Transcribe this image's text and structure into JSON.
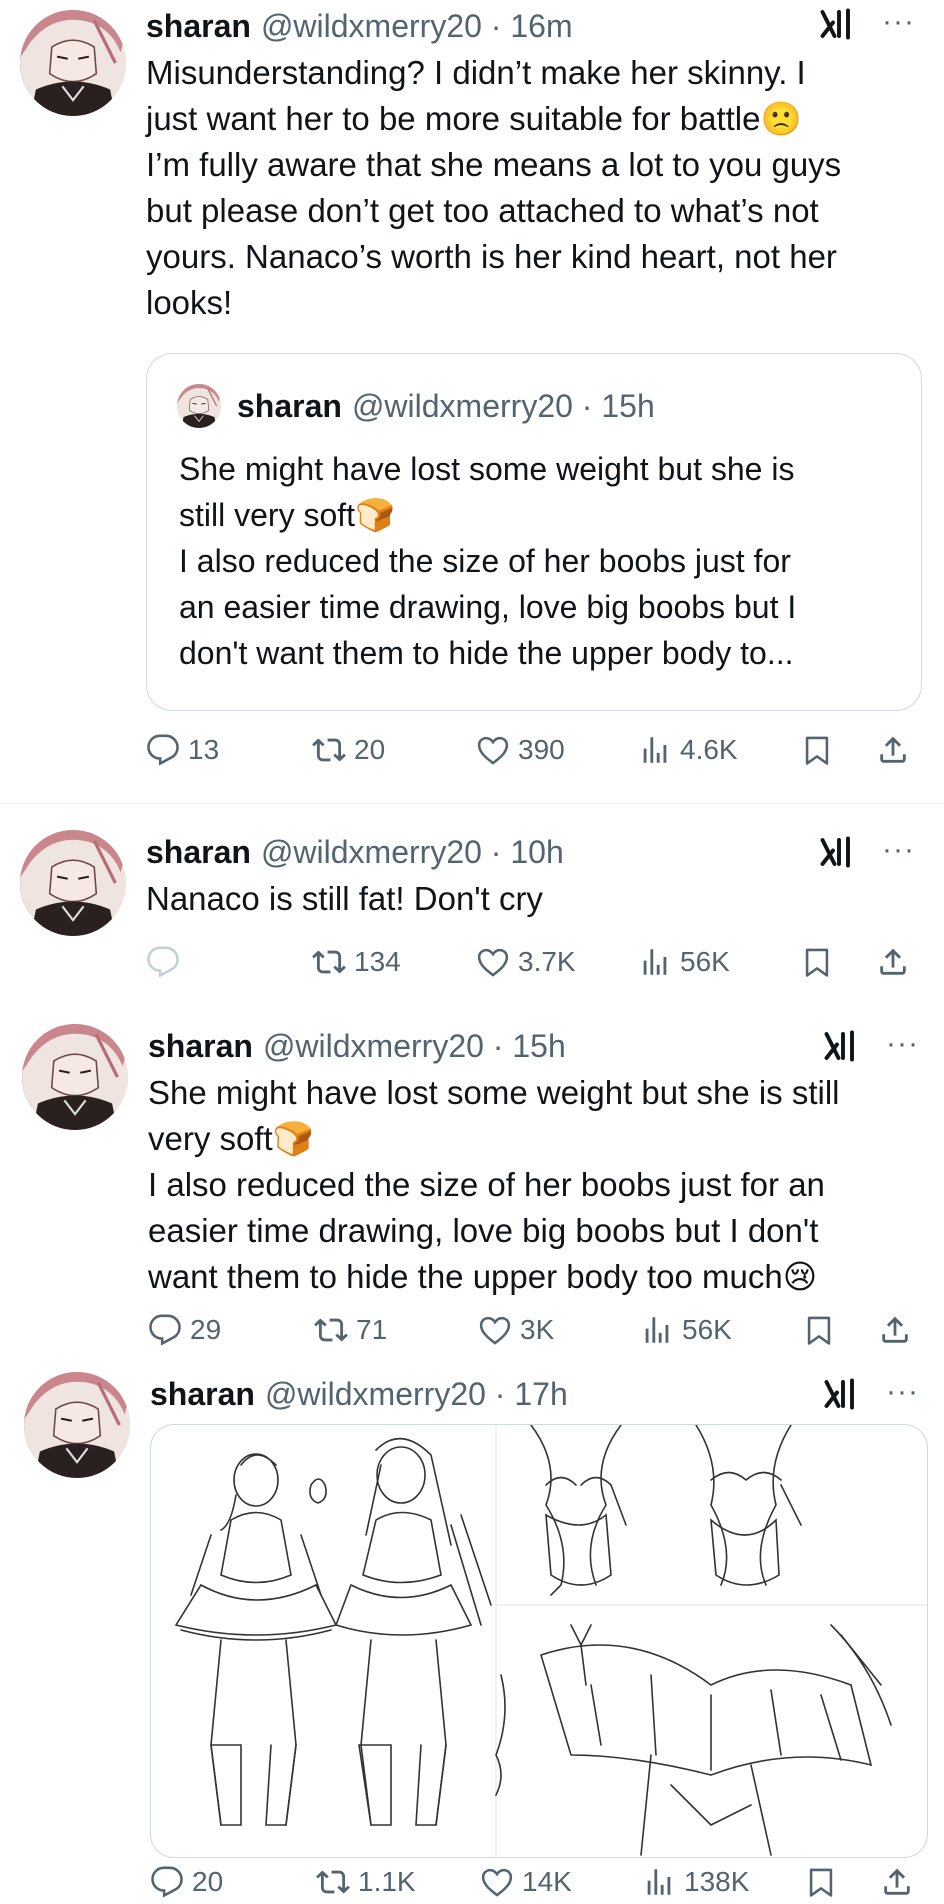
{
  "tweets": [
    {
      "name": "sharan",
      "handle": "@wildxmerry20 · 16m",
      "text": "Misunderstanding? I didn’t make her skinny. I\njust want her to be more suitable for battle🙁\nI’m fully aware that she means a lot to you guys\nbut please don’t get too attached to what’s not\nyours. Nanaco’s worth is her kind heart, not her\nlooks!",
      "quote": {
        "name": "sharan",
        "handle": "@wildxmerry20 · 15h",
        "text": "She might have lost some weight but she is\nstill very soft🍞\nI also reduced the size of her boobs just for\nan easier time drawing, love big boobs but I\ndon't want them to hide the upper body to..."
      },
      "replies": "13",
      "reposts": "20",
      "likes": "390",
      "views": "4.6K"
    },
    {
      "name": "sharan",
      "handle": "@wildxmerry20 · 10h",
      "text": "Nanaco is still fat! Don't cry",
      "replies": "",
      "reposts": "134",
      "likes": "3.7K",
      "views": "56K"
    },
    {
      "name": "sharan",
      "handle": "@wildxmerry20 · 15h",
      "text": "She might have lost some weight but she is still\nvery soft🍞\nI also reduced the size of her boobs just for an\neasier time drawing, love big boobs but I don't\nwant them to hide the upper body too much😢",
      "replies": "29",
      "reposts": "71",
      "likes": "3K",
      "views": "56K"
    },
    {
      "name": "sharan",
      "handle": "@wildxmerry20 · 17h",
      "text": "",
      "replies": "20",
      "reposts": "1.1K",
      "likes": "14K",
      "views": "138K"
    }
  ],
  "icons": {
    "more": "more-horizontal-icon",
    "grok": "grok-icon",
    "reply": "reply-icon",
    "repost": "repost-icon",
    "like": "like-icon",
    "views": "views-icon",
    "bookmark": "bookmark-icon",
    "share": "share-icon"
  },
  "colors": {
    "text": "#0f1419",
    "secondary": "#536471",
    "border": "#cfd9de"
  }
}
